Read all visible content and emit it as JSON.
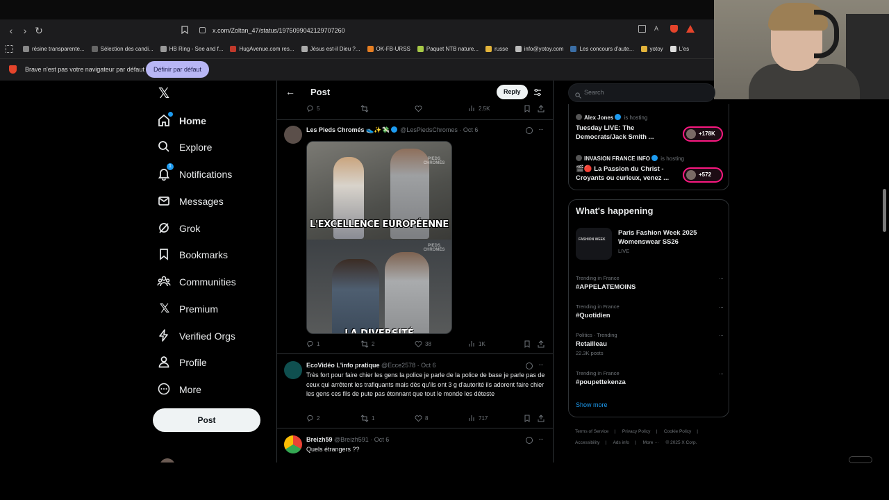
{
  "browser": {
    "url": "x.com/Zoltan_47/status/1975099042129707260",
    "bookmarks": [
      {
        "label": "résine transparente...",
        "color": "#888"
      },
      {
        "label": "Sélection des candi...",
        "color": "#666"
      },
      {
        "label": "HB Ring - See and f...",
        "color": "#999"
      },
      {
        "label": "HugAvenue.com res...",
        "color": "#c0392b"
      },
      {
        "label": "Jésus est-il Dieu ?...",
        "color": "#aaa"
      },
      {
        "label": "OK-FB-URSS",
        "color": "#e67e22"
      },
      {
        "label": "Paquet NTB nature...",
        "color": "#a7c947"
      },
      {
        "label": "russe",
        "color": "#e2b33b"
      },
      {
        "label": "info@yotoy.com",
        "color": "#bbb"
      },
      {
        "label": "Les concours d'aute...",
        "color": "#3b6ea5"
      },
      {
        "label": "yotoy",
        "color": "#e2b33b"
      },
      {
        "label": "L'es",
        "color": "#ddd"
      }
    ],
    "infobar_text": "Brave n'est pas votre navigateur par défaut",
    "infobar_button": "Définir par défaut"
  },
  "nav": {
    "items": [
      {
        "label": "Home",
        "icon": "home-icon"
      },
      {
        "label": "Explore",
        "icon": "search-icon"
      },
      {
        "label": "Notifications",
        "icon": "bell-icon",
        "badge": "1"
      },
      {
        "label": "Messages",
        "icon": "mail-icon"
      },
      {
        "label": "Grok",
        "icon": "grok-icon"
      },
      {
        "label": "Bookmarks",
        "icon": "bookmark-icon"
      },
      {
        "label": "Communities",
        "icon": "communities-icon"
      },
      {
        "label": "Premium",
        "icon": "x-logo-icon"
      },
      {
        "label": "Verified Orgs",
        "icon": "lightning-icon"
      },
      {
        "label": "Profile",
        "icon": "person-icon"
      },
      {
        "label": "More",
        "icon": "more-circle-icon"
      }
    ],
    "post_button": "Post"
  },
  "main": {
    "title": "Post",
    "reply_button": "Reply",
    "top_actions": {
      "replies": "5",
      "likes": "",
      "views": "2.5K"
    },
    "tweets": [
      {
        "name": "Les Pieds Chromés 👟✨💸",
        "handle": "@LesPiedsChromes · Oct 6",
        "text": "",
        "meme_caption_top": "L'EXCELLENCE EUROPÉENNE",
        "meme_caption_bottom": "LA DIVERSITÉ",
        "watermark": "PIEDS CHROMÉS",
        "avatar_color": "#5b4f4a",
        "replies": "1",
        "reposts": "2",
        "likes": "38",
        "views": "1K"
      },
      {
        "name": "EcoVidéo L'info pratique",
        "handle": "@Ecce2578 · Oct 6",
        "text": "Très fort pour faire chier les gens la police je parle de la police de base je parle pas de ceux qui arrêtent les trafiquants mais dès qu'ils ont 3 g d'autorité ils adorent faire chier les gens ces fils de pute pas étonnant que tout le monde les déteste",
        "avatar_color": "#0f4f4f",
        "replies": "2",
        "reposts": "1",
        "likes": "8",
        "views": "717"
      },
      {
        "name": "Breizh59",
        "handle": "@Breizh591 · Oct 6",
        "text": "Quels étrangers ??",
        "avatar_color": "#3d7fd9"
      }
    ]
  },
  "sidebar": {
    "search_placeholder": "Search",
    "spaces": [
      {
        "host": "Alex Jones",
        "status": "is hosting",
        "title": "Tuesday LIVE: The Democrats/Jack Smith ...",
        "listeners": "+178K"
      },
      {
        "host": "INVASION FRANCE INFO",
        "status": "is hosting",
        "title": "🎬🔴 La Passion du Christ - Croyants ou curieux, venez ...",
        "listeners": "+572"
      }
    ],
    "happening_title": "What's happening",
    "event": {
      "title": "Paris Fashion Week 2025 Womenswear SS26",
      "status": "LIVE",
      "thumb_text": "FASHION WEEK"
    },
    "trends": [
      {
        "context": "Trending in France",
        "name": "#APPELATEMOINS",
        "posts": ""
      },
      {
        "context": "Trending in France",
        "name": "#Quotidien",
        "posts": ""
      },
      {
        "context": "Politics · Trending",
        "name": "Retailleau",
        "posts": "22.3K posts"
      },
      {
        "context": "Trending in France",
        "name": "#poupettekenza",
        "posts": ""
      }
    ],
    "show_more": "Show more",
    "footer": [
      "Terms of Service",
      "|",
      "Privacy Policy",
      "|",
      "Cookie Policy",
      "|",
      "Accessibility",
      "|",
      "Ads info",
      "|",
      "More ···",
      "© 2025 X Corp."
    ]
  }
}
